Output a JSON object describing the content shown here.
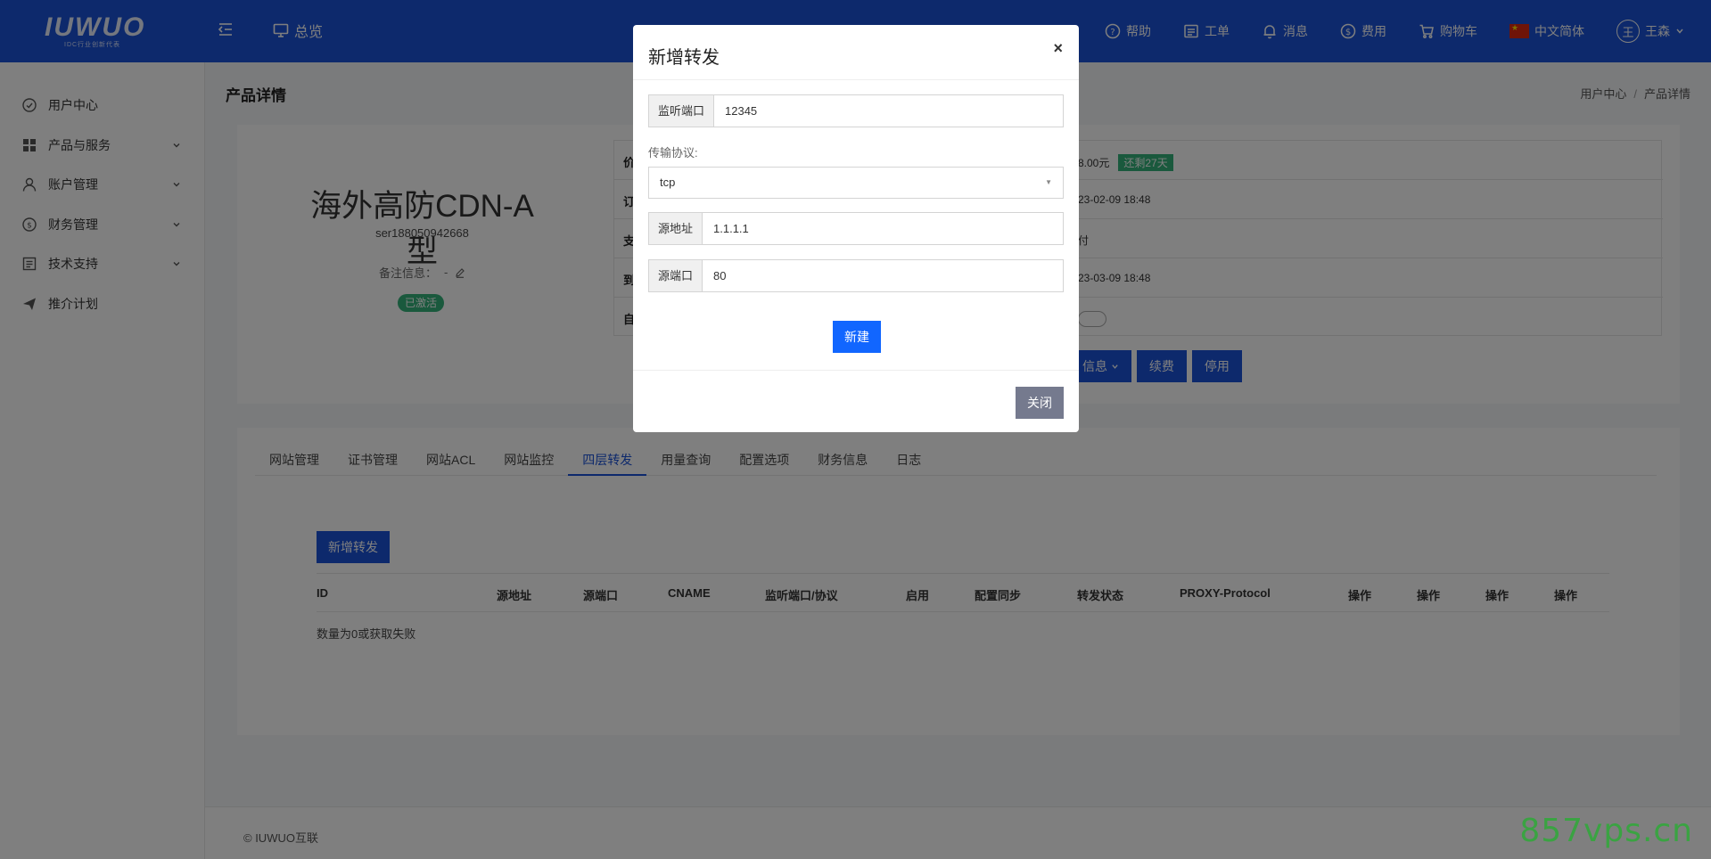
{
  "header": {
    "logo_text": "IUWUO",
    "logo_sub": "IDC行业创新代表",
    "overview": "总览",
    "nav": [
      {
        "label": "帮助",
        "icon": "help-icon"
      },
      {
        "label": "工单",
        "icon": "ticket-icon"
      },
      {
        "label": "消息",
        "icon": "bell-icon"
      },
      {
        "label": "费用",
        "icon": "dollar-icon"
      },
      {
        "label": "购物车",
        "icon": "cart-icon"
      }
    ],
    "language": "中文简体",
    "avatar_char": "王",
    "user": "王森"
  },
  "sidebar": {
    "items": [
      {
        "label": "用户中心",
        "icon": "dashboard-icon"
      },
      {
        "label": "产品与服务",
        "icon": "grid-icon"
      },
      {
        "label": "账户管理",
        "icon": "user-icon"
      },
      {
        "label": "财务管理",
        "icon": "dollar-icon"
      },
      {
        "label": "技术支持",
        "icon": "document-icon"
      },
      {
        "label": "推介计划",
        "icon": "send-icon"
      }
    ]
  },
  "page": {
    "title": "产品详情",
    "breadcrumb": [
      "用户中心",
      "产品详情"
    ],
    "product_name": "海外高防CDN-A型",
    "product_id": "ser188050942668",
    "remark_label": "备注信息：",
    "remark_value": "-",
    "status": "已激活",
    "info_rows": [
      {
        "label": "价",
        "value": "8.00元",
        "tag": "还剩27天"
      },
      {
        "label": "订",
        "value": "23-02-09 18:48"
      },
      {
        "label": "支",
        "value": "付"
      },
      {
        "label": "到",
        "value": "23-03-09 18:48"
      },
      {
        "label": "自",
        "value": ""
      }
    ],
    "actions": [
      "信息",
      "续费",
      "停用"
    ]
  },
  "tabs": [
    "网站管理",
    "证书管理",
    "网站ACL",
    "网站监控",
    "四层转发",
    "用量查询",
    "配置选项",
    "财务信息",
    "日志"
  ],
  "active_tab": "四层转发",
  "forward": {
    "add_button": "新增转发",
    "columns": [
      "ID",
      "源地址",
      "源端口",
      "CNAME",
      "监听端口/协议",
      "启用",
      "配置同步",
      "转发状态",
      "PROXY-Protocol",
      "操作",
      "操作",
      "操作",
      "操作"
    ],
    "empty_message": "数量为0或获取失败"
  },
  "modal": {
    "title": "新增转发",
    "listen_port_label": "监听端口",
    "listen_port_value": "12345",
    "protocol_label": "传输协议:",
    "protocol_value": "tcp",
    "source_addr_label": "源地址",
    "source_addr_value": "1.1.1.1",
    "source_port_label": "源端口",
    "source_port_value": "80",
    "create_button": "新建",
    "close_button": "关闭"
  },
  "footer": "© IUWUO互联",
  "watermark": "857vps.cn"
}
